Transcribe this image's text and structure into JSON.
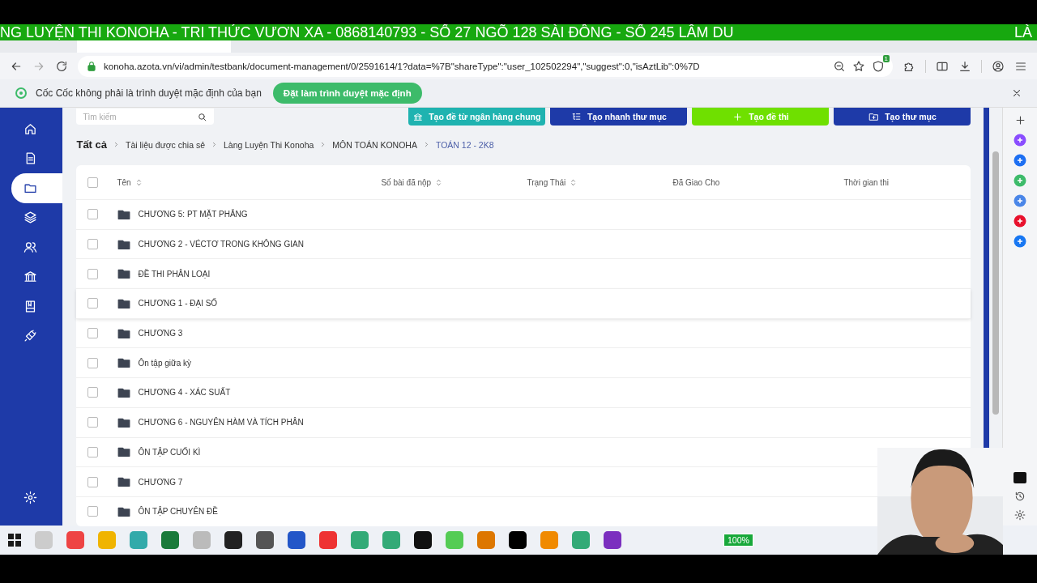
{
  "ticker": {
    "text": "NG LUYỆN THI KONOHA - TRI THỨC VƯƠN XA - 0868140793 - SỐ 27 NGÕ 128 SÀI ĐỒNG - SỐ 245 LÂM DU",
    "tail": "LÀ"
  },
  "address_bar": {
    "url": "konoha.azota.vn/vi/admin/testbank/document-management/0/2591614/1?data=%7B\"shareType\":\"user_102502294\",\"suggest\":0,\"isAztLib\":0%7D",
    "extension_badge": "1"
  },
  "infobar": {
    "message": "Cốc Cốc không phải là trình duyệt mặc định của bạn",
    "button": "Đặt làm trình duyệt mặc định"
  },
  "sidebar": {
    "items": [
      {
        "kind": "home",
        "selected": false
      },
      {
        "kind": "document",
        "selected": false
      },
      {
        "kind": "folder",
        "selected": true
      },
      {
        "kind": "layers",
        "selected": false
      },
      {
        "kind": "users",
        "selected": false
      },
      {
        "kind": "bank",
        "selected": false
      },
      {
        "kind": "book",
        "selected": false
      },
      {
        "kind": "plug",
        "selected": false
      }
    ]
  },
  "toolbar": {
    "search_placeholder": "Tìm kiếm",
    "buttons": [
      {
        "label": "Tạo đề từ ngân hàng chung",
        "kind": "bank",
        "color": "#1fb3b0"
      },
      {
        "label": "Tạo nhanh thư mục",
        "kind": "list",
        "color": "#1e3aa8"
      },
      {
        "label": "Tạo đề thi",
        "kind": "plus",
        "color": "#6fe000"
      },
      {
        "label": "Tạo thư mục",
        "kind": "folder",
        "color": "#1e3aa8"
      }
    ]
  },
  "breadcrumb": [
    "Tất cả",
    "Tài liệu được chia sẻ",
    "Làng Luyện Thi Konoha",
    "MÔN TOÁN KONOHA",
    "TOÁN 12 - 2K8"
  ],
  "table": {
    "select_all_checked": false,
    "columns": [
      {
        "label": "Tên",
        "sortable": true
      },
      {
        "label": "Số bài đã nộp",
        "sortable": true
      },
      {
        "label": "Trạng Thái",
        "sortable": true
      },
      {
        "label": "Đã Giao Cho",
        "sortable": false
      },
      {
        "label": "Thời gian thi",
        "sortable": false
      }
    ],
    "rows": [
      {
        "name": "CHƯƠNG 5: PT MẶT PHẲNG",
        "checked": false
      },
      {
        "name": "CHƯƠNG 2 - VÉCTƠ TRONG KHÔNG GIAN",
        "checked": false
      },
      {
        "name": "ĐỀ THI PHÂN LOẠI",
        "checked": false
      },
      {
        "name": "CHƯƠNG 1 - ĐẠI SỐ",
        "checked": false
      },
      {
        "name": "CHƯƠNG 3",
        "checked": false
      },
      {
        "name": "Ôn tập giữa kỳ",
        "checked": false
      },
      {
        "name": "CHƯƠNG 4 - XÁC SUẤT",
        "checked": false
      },
      {
        "name": "CHƯƠNG 6 - NGUYÊN HÀM VÀ TÍCH PHÂN",
        "checked": false
      },
      {
        "name": "ÔN TẬP CUỐI KÌ",
        "checked": false
      },
      {
        "name": "CHƯƠNG 7",
        "checked": false
      },
      {
        "name": "ÔN TẬP CHUYÊN ĐỀ",
        "checked": false
      }
    ]
  },
  "taskbar": {
    "battery": "100%"
  }
}
